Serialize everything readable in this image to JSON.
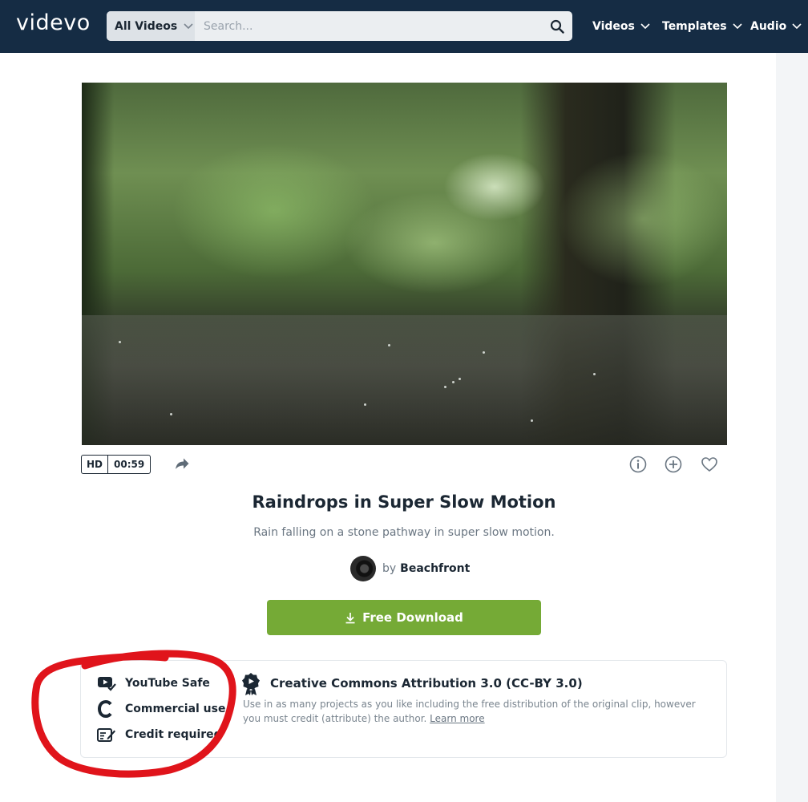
{
  "header": {
    "logo": "videvo",
    "scope_label": "All Videos",
    "search_placeholder": "Search...",
    "nav": [
      {
        "label": "Videos"
      },
      {
        "label": "Templates"
      },
      {
        "label": "Audio"
      }
    ]
  },
  "video": {
    "quality": "HD",
    "duration": "00:59",
    "title": "Raindrops in Super Slow Motion",
    "description": "Rain falling on a stone pathway in super slow motion.",
    "author_prefix": "by",
    "author": "Beachfront",
    "download_label": "Free Download"
  },
  "license": {
    "features": [
      {
        "label": "YouTube Safe",
        "icon": "youtube-safe-icon"
      },
      {
        "label": "Commercial use",
        "icon": "commercial-use-icon"
      },
      {
        "label": "Credit required",
        "icon": "credit-required-icon"
      }
    ],
    "title": "Creative Commons Attribution 3.0 (CC-BY 3.0)",
    "text": "Use in as many projects as you like including the free distribution of the original clip, however you must credit (attribute) the author.",
    "learn_more": "Learn more"
  },
  "colors": {
    "header_bg": "#152c44",
    "download_bg": "#75aa36",
    "annotation": "#e0141b"
  }
}
